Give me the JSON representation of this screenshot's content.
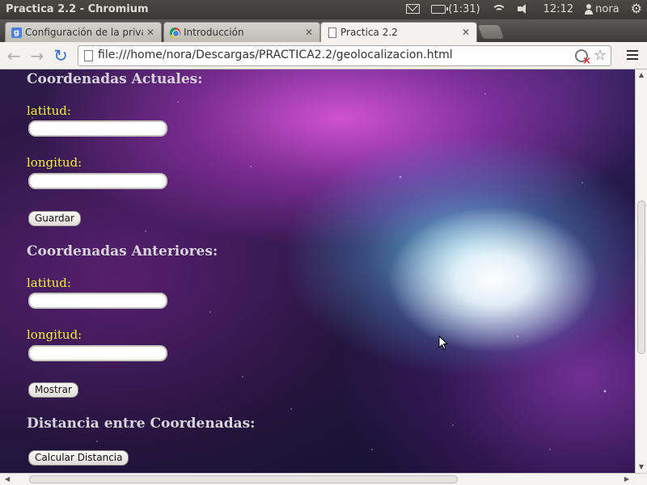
{
  "panel": {
    "window_title": "Practica 2.2 - Chromium",
    "battery": "(1:31)",
    "clock": "12:12",
    "user": "nora"
  },
  "tabs": [
    {
      "label": "Configuración de la privac",
      "favicon": "google-icon",
      "active": false
    },
    {
      "label": "Introducción",
      "favicon": "chrome-icon",
      "active": false
    },
    {
      "label": "Practica 2.2",
      "favicon": "page-icon",
      "active": true
    }
  ],
  "toolbar": {
    "url": "file:///home/nora/Descargas/PRACTICA2.2/geolocalizacion.html"
  },
  "page": {
    "current": {
      "title": "Coordenadas Actuales:",
      "lat_label": "latitud:",
      "lat_value": "",
      "lon_label": "longitud:",
      "lon_value": "",
      "save_button": "Guardar"
    },
    "previous": {
      "title": "Coordenadas Anteriores:",
      "lat_label": "latitud:",
      "lat_value": "",
      "lon_label": "longitud:",
      "lon_value": "",
      "show_button": "Mostrar"
    },
    "distance": {
      "title": "Distancia entre Coordenadas:",
      "calc_button": "Calcular Distancia"
    }
  },
  "colors": {
    "label_yellow": "#f4ef3a",
    "title_gray": "#d8d4dc"
  }
}
